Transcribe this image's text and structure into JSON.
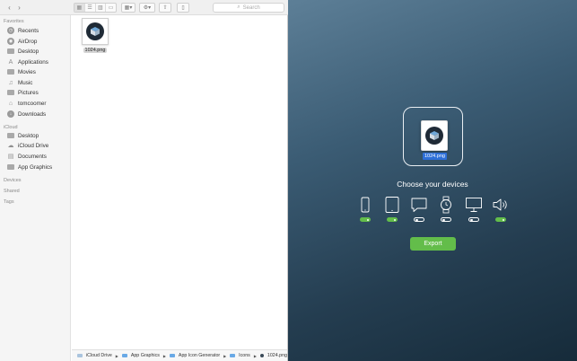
{
  "finder": {
    "toolbar": {
      "back_icon": "chevron-left-icon",
      "forward_icon": "chevron-right-icon",
      "view_modes": [
        "icon-view",
        "list-view",
        "column-view",
        "gallery-view"
      ],
      "search_placeholder": "Search"
    },
    "sidebar": {
      "favorites_title": "Favorites",
      "favorites": [
        {
          "label": "Recents",
          "icon": "clock-icon"
        },
        {
          "label": "AirDrop",
          "icon": "airdrop-icon"
        },
        {
          "label": "Desktop",
          "icon": "desktop-icon"
        },
        {
          "label": "Applications",
          "icon": "applications-icon"
        },
        {
          "label": "Movies",
          "icon": "film-icon"
        },
        {
          "label": "Music",
          "icon": "music-note-icon"
        },
        {
          "label": "Pictures",
          "icon": "camera-icon"
        },
        {
          "label": "tomcoomer",
          "icon": "home-icon"
        },
        {
          "label": "Downloads",
          "icon": "download-icon"
        }
      ],
      "icloud_title": "iCloud",
      "icloud": [
        {
          "label": "Desktop",
          "icon": "desktop-icon"
        },
        {
          "label": "iCloud Drive",
          "icon": "cloud-icon"
        },
        {
          "label": "Documents",
          "icon": "document-icon"
        },
        {
          "label": "App Graphics",
          "icon": "folder-icon"
        }
      ],
      "devices_title": "Devices",
      "shared_title": "Shared",
      "tags_title": "Tags"
    },
    "files": [
      {
        "name": "1024.png",
        "icon": "app-icon-image"
      }
    ],
    "pathbar": [
      "iCloud Drive",
      "App Graphics",
      "App Icon Generator",
      "Icons",
      "1024.png"
    ]
  },
  "app": {
    "dropped_file": "1024.png",
    "choose_title": "Choose your devices",
    "devices": [
      {
        "name": "iphone",
        "icon": "iphone-icon",
        "enabled": true
      },
      {
        "name": "ipad",
        "icon": "ipad-icon",
        "enabled": true
      },
      {
        "name": "imessage",
        "icon": "message-bubble-icon",
        "enabled": false
      },
      {
        "name": "watch",
        "icon": "watch-icon",
        "enabled": false
      },
      {
        "name": "mac",
        "icon": "monitor-icon",
        "enabled": false
      },
      {
        "name": "carplay",
        "icon": "speaker-icon",
        "enabled": true
      }
    ],
    "export_label": "Export",
    "colors": {
      "accent": "#63bd4a",
      "selection": "#2d6fd8",
      "background_top": "#5d7f97",
      "background_bottom": "#162b3a"
    }
  }
}
